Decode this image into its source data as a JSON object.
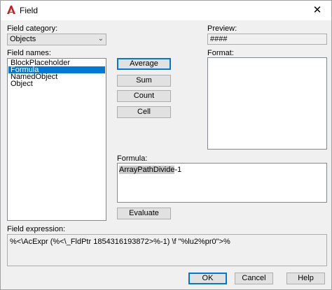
{
  "window": {
    "title": "Field",
    "icon": "autocad-a-icon",
    "close_label": "✕"
  },
  "field_category": {
    "label": "Field category:",
    "selected": "Objects"
  },
  "field_names": {
    "label": "Field names:",
    "items": [
      "BlockPlaceholder",
      "Formula",
      "NamedObject",
      "Object"
    ],
    "selected_index": 1
  },
  "formula_buttons": {
    "average": "Average",
    "sum": "Sum",
    "count": "Count",
    "cell": "Cell"
  },
  "preview": {
    "label": "Preview:",
    "value": "####"
  },
  "format": {
    "label": "Format:"
  },
  "formula": {
    "label": "Formula:",
    "highlighted": "ArrayPathDivide",
    "rest": "-1"
  },
  "evaluate_label": "Evaluate",
  "field_expression": {
    "label": "Field expression:",
    "value": "%<\\AcExpr (%<\\_FldPtr 1854316193872>%-1) \\f \"%lu2%pr0\">%"
  },
  "footer": {
    "ok": "OK",
    "cancel": "Cancel",
    "help": "Help"
  },
  "colors": {
    "accent": "#0078d7",
    "app_icon": "#d0191f"
  }
}
